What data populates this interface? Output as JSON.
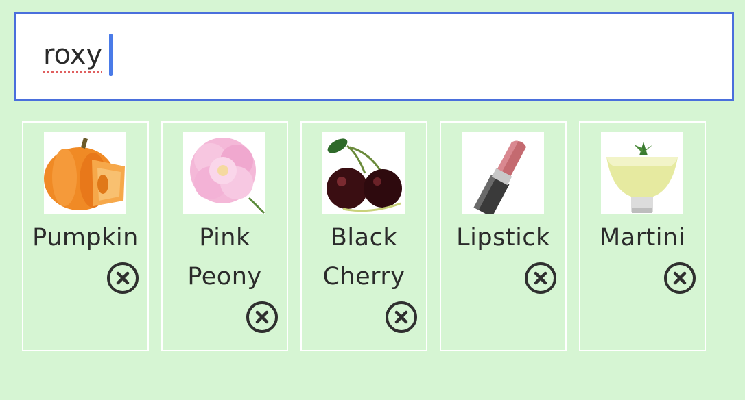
{
  "search": {
    "value": "roxy"
  },
  "cards": [
    {
      "label": "Pumpkin",
      "image": "pumpkin",
      "remove_icon": "close-circle-icon"
    },
    {
      "label": "Pink Peony",
      "image": "pink-peony",
      "remove_icon": "close-circle-icon"
    },
    {
      "label": "Black Cherry",
      "image": "black-cherry",
      "remove_icon": "close-circle-icon"
    },
    {
      "label": "Lipstick",
      "image": "lipstick",
      "remove_icon": "close-circle-icon"
    },
    {
      "label": "Martini",
      "image": "martini",
      "remove_icon": "close-circle-icon"
    }
  ],
  "colors": {
    "background": "#d6f5d3",
    "search_border": "#4a6fdc",
    "caret": "#4a7be8",
    "card_border": "#ffffff",
    "text": "#2b2b2b"
  }
}
